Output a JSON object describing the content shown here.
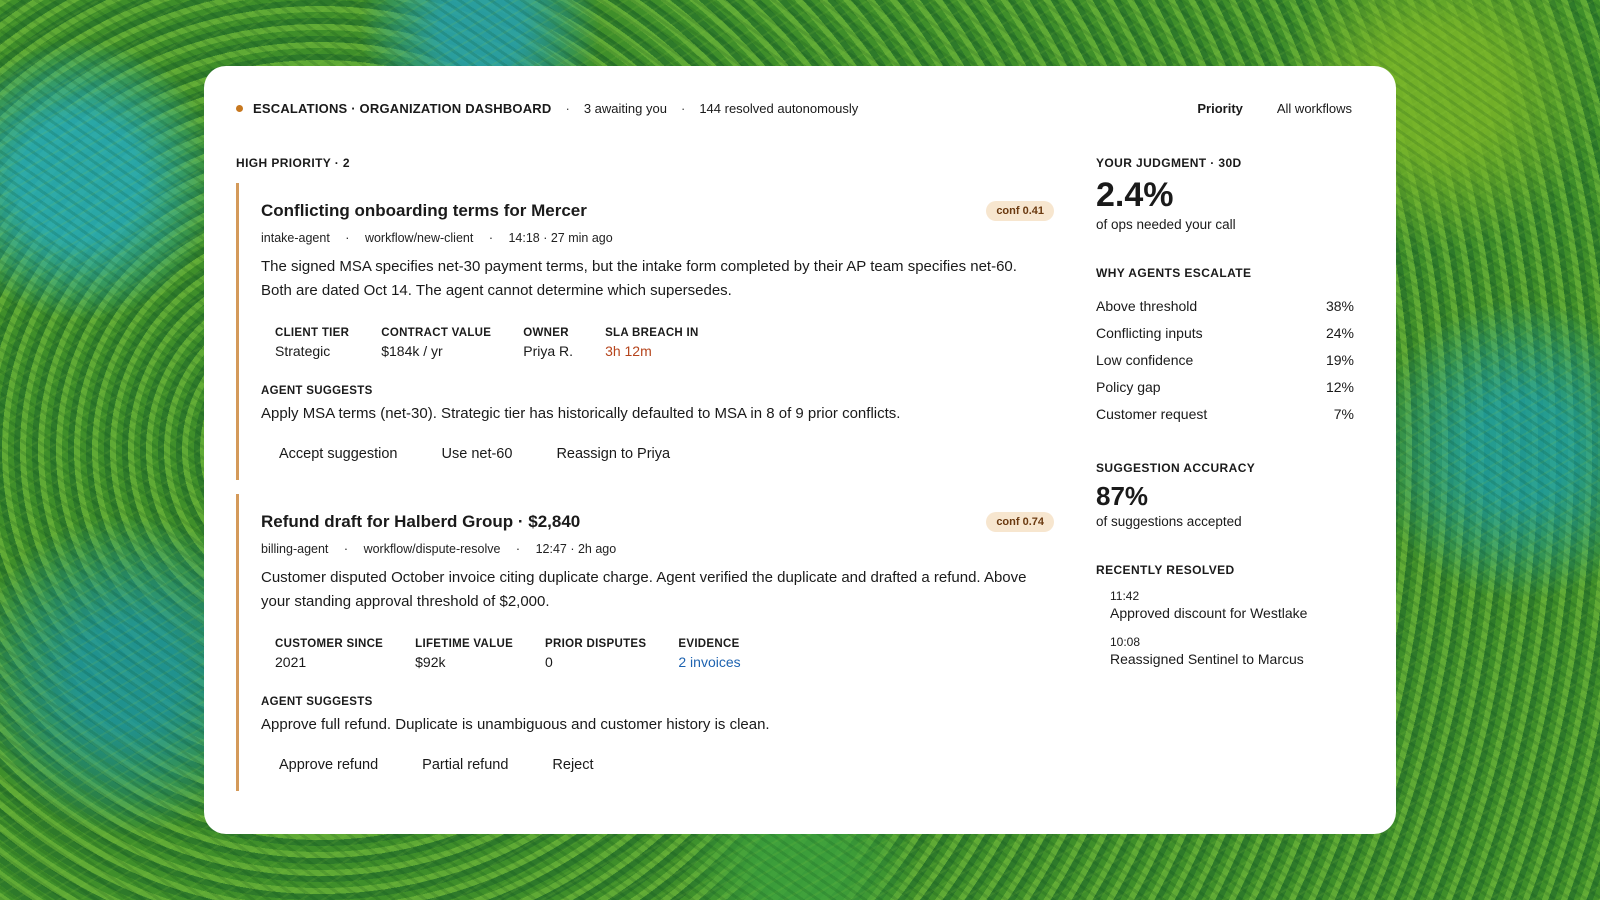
{
  "header": {
    "title": "ESCALATIONS · ORGANIZATION DASHBOARD",
    "awaiting": "3 awaiting you",
    "resolved": "144 resolved autonomously",
    "tabs": [
      {
        "label": "Priority",
        "active": true
      },
      {
        "label": "All workflows",
        "active": false
      }
    ]
  },
  "section": {
    "label": "HIGH PRIORITY · 2"
  },
  "cards": [
    {
      "title": "Conflicting onboarding terms for Mercer",
      "conf": "conf 0.41",
      "agent": "intake-agent",
      "workflow": "workflow/new-client",
      "time": "14:18 · 27 min ago",
      "description": "The signed MSA specifies net-30 payment terms, but the intake form completed by their AP team specifies net-60. Both are dated Oct 14. The agent cannot determine which supersedes.",
      "facts": [
        {
          "key": "CLIENT TIER",
          "value": "Strategic"
        },
        {
          "key": "CONTRACT VALUE",
          "value": "$184k / yr"
        },
        {
          "key": "OWNER",
          "value": "Priya R."
        },
        {
          "key": "SLA BREACH IN",
          "value": "3h 12m"
        }
      ],
      "suggest_label": "AGENT SUGGESTS",
      "suggestion": "Apply MSA terms (net-30). Strategic tier has historically defaulted to MSA in 8 of 9 prior conflicts.",
      "actions": [
        "Accept suggestion",
        "Use net-60",
        "Reassign to Priya"
      ]
    },
    {
      "title": "Refund draft for Halberd Group · $2,840",
      "conf": "conf 0.74",
      "agent": "billing-agent",
      "workflow": "workflow/dispute-resolve",
      "time": "12:47 · 2h ago",
      "description": "Customer disputed October invoice citing duplicate charge. Agent verified the duplicate and drafted a refund. Above your standing approval threshold of $2,000.",
      "facts": [
        {
          "key": "CUSTOMER SINCE",
          "value": "2021"
        },
        {
          "key": "LIFETIME VALUE",
          "value": "$92k"
        },
        {
          "key": "PRIOR DISPUTES",
          "value": "0"
        },
        {
          "key": "EVIDENCE",
          "value": "2 invoices"
        }
      ],
      "suggest_label": "AGENT SUGGESTS",
      "suggestion": "Approve full refund. Duplicate is unambiguous and customer history is clean.",
      "actions": [
        "Approve refund",
        "Partial refund",
        "Reject"
      ]
    }
  ],
  "side": {
    "judgment": {
      "label": "YOUR JUDGMENT · 30D",
      "value": "2.4%",
      "caption": "of ops needed your call"
    },
    "why": {
      "label": "WHY AGENTS ESCALATE",
      "items": [
        {
          "name": "Above threshold",
          "pct": "38%"
        },
        {
          "name": "Conflicting inputs",
          "pct": "24%"
        },
        {
          "name": "Low confidence",
          "pct": "19%"
        },
        {
          "name": "Policy gap",
          "pct": "12%"
        },
        {
          "name": "Customer request",
          "pct": "7%"
        }
      ]
    },
    "accuracy": {
      "label": "SUGGESTION ACCURACY",
      "value": "87%",
      "caption": "of suggestions accepted"
    },
    "recent": {
      "label": "RECENTLY RESOLVED",
      "items": [
        {
          "time": "11:42",
          "text": "Approved discount for Westlake"
        },
        {
          "time": "10:08",
          "text": "Reassigned Sentinel to Marcus"
        }
      ]
    }
  }
}
